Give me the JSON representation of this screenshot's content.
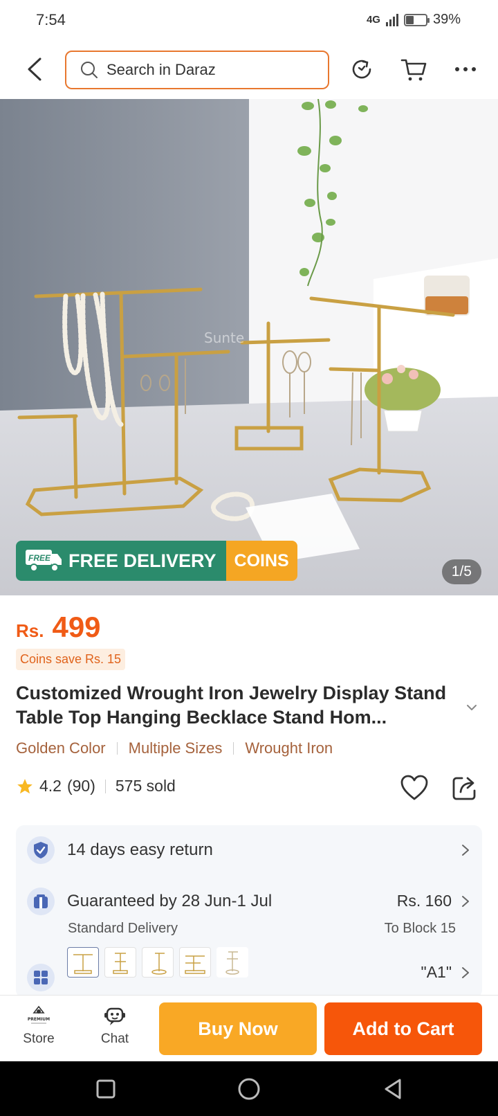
{
  "status_bar": {
    "time": "7:54",
    "network": "4G",
    "battery_percent": "39%",
    "battery_level": 0.39
  },
  "header": {
    "search_placeholder": "Search in Daraz"
  },
  "hero": {
    "promo_free_badge": "FREE",
    "promo_free_text": "FREE DELIVERY",
    "promo_coins_text": "COINS",
    "image_counter": "1/5"
  },
  "product": {
    "price_currency": "Rs.",
    "price_value": "499",
    "coins_save": "Coins save Rs. 15",
    "title": "Customized Wrought Iron Jewelry Display Stand Table Top Hanging Becklace Stand Hom...",
    "tags": [
      "Golden Color",
      "Multiple Sizes",
      "Wrought Iron"
    ],
    "rating": "4.2",
    "rating_count": "(90)",
    "sold": "575 sold"
  },
  "info": {
    "returns": "14 days easy return",
    "delivery_title": "Guaranteed by 28 Jun-1 Jul",
    "delivery_sub": "Standard Delivery",
    "delivery_price": "Rs. 160",
    "delivery_to": "To Block 15",
    "variant_selected": "\"A1\""
  },
  "bottom_bar": {
    "store_label": "Store",
    "store_logo_text": "PREMIUM",
    "chat_label": "Chat",
    "buy_now": "Buy Now",
    "add_to_cart": "Add to Cart"
  },
  "colors": {
    "accent_orange": "#f6560a",
    "buy_yellow": "#f9a825",
    "price": "#f05b16",
    "tag_brown": "#a5623c",
    "free_green": "#2b8b6c"
  }
}
